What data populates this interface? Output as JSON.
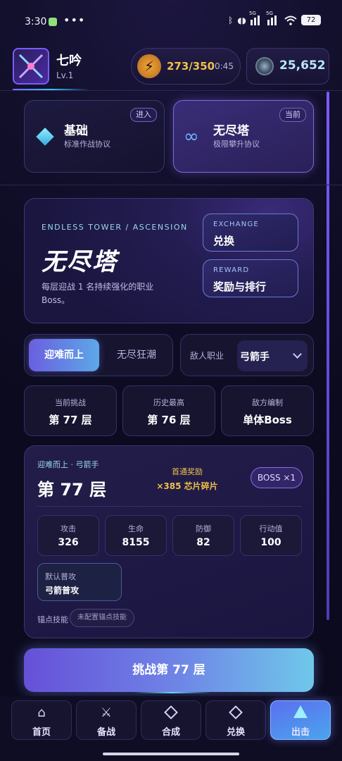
{
  "status_bar": {
    "time": "3:30",
    "dots": "•••",
    "network_tags": [
      "5G",
      "5G"
    ],
    "battery": "72"
  },
  "player": {
    "name": "七吟",
    "level": "Lv.1"
  },
  "resources": {
    "energy": "273/350",
    "energy_timer": "0:45",
    "energy_icon": "⚡",
    "gems": "25,652"
  },
  "modes": [
    {
      "title": "基础",
      "subtitle": "标准作战协议",
      "badge": "进入",
      "active": false
    },
    {
      "title": "无尽塔",
      "subtitle": "极限攀升协议",
      "badge": "当前",
      "active": true
    }
  ],
  "hero": {
    "eyebrow": "ENDLESS TOWER / ASCENSION",
    "title": "无尽塔",
    "description": "每层迎战 1 名持续强化的职业 Boss。",
    "buttons": [
      {
        "en": "EXCHANGE",
        "cn": "兑换"
      },
      {
        "en": "REWARD",
        "cn": "奖励与排行"
      }
    ]
  },
  "tabs": {
    "active": "迎难而上",
    "inactive": "无尽狂潮"
  },
  "enemy_class": {
    "label": "敌人职业",
    "selected": "弓箭手"
  },
  "stats": [
    {
      "label": "当前挑战",
      "value": "第 77 层"
    },
    {
      "label": "历史最高",
      "value": "第 76 层"
    },
    {
      "label": "敌方编制",
      "value": "单体Boss"
    }
  ],
  "detail": {
    "subtitle": "迎难而上 · 弓箭手",
    "floor": "第 77 层",
    "reward_title": "首通奖励",
    "reward_value": "×385 芯片碎片",
    "boss_badge": "BOSS ×1",
    "attributes": [
      {
        "label": "攻击",
        "value": "326"
      },
      {
        "label": "生命",
        "value": "8155"
      },
      {
        "label": "防御",
        "value": "82"
      },
      {
        "label": "行动值",
        "value": "100"
      }
    ],
    "skill": {
      "label": "默认普攻",
      "value": "弓箭普攻"
    },
    "anchor_label": "锚点技能",
    "anchor_value": "未配置锚点技能"
  },
  "challenge_button": "挑战第 77 层",
  "nav": [
    {
      "label": "首页",
      "icon": "home-icon",
      "glyph": "⌂",
      "active": false
    },
    {
      "label": "备战",
      "icon": "crossed-swords-icon",
      "glyph": "⚔",
      "active": false
    },
    {
      "label": "合成",
      "icon": "diamond-icon",
      "glyph": "",
      "active": false
    },
    {
      "label": "兑换",
      "icon": "diamond-icon",
      "glyph": "",
      "active": false
    },
    {
      "label": "出击",
      "icon": "triangle-icon",
      "glyph": "",
      "active": true
    }
  ],
  "colors": {
    "background": "#110f2a",
    "accent_purple": "#7a5cff",
    "accent_cyan": "#6fc8ea",
    "gold": "#f0c04a"
  }
}
